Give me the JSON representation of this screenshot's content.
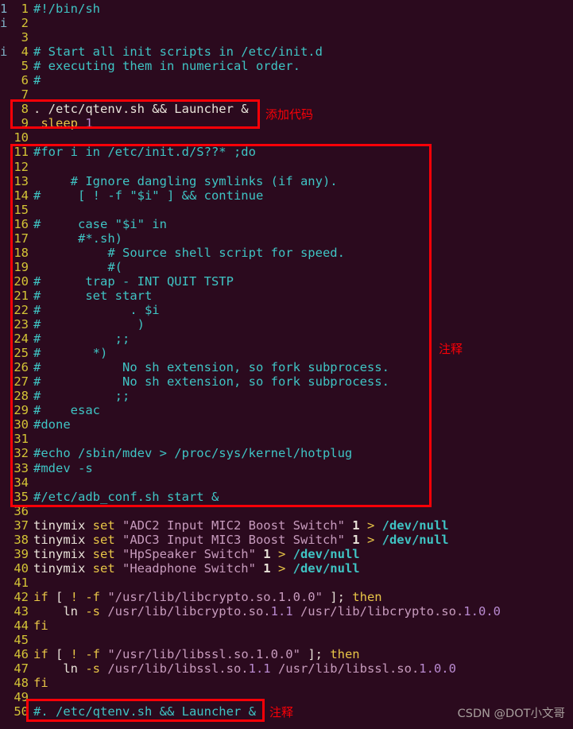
{
  "editor": {
    "filetype": "shell-script",
    "background_color": "#2b0a1e",
    "linenumber_color": "#d4c436",
    "comment_color": "#3fc4c4",
    "text_color": "#e8e2d8",
    "string_color": "#c79bbd",
    "number_color": "#b98ad0",
    "keyword_color": "#e8c547",
    "highlight_box_color": "#fb0007",
    "left_edge_sliver": "1\ni\n\ni"
  },
  "lines": [
    {
      "n": "1",
      "tokens": [
        {
          "t": "#!/bin/sh",
          "c": "cmt"
        }
      ]
    },
    {
      "n": "2",
      "tokens": []
    },
    {
      "n": "3",
      "tokens": []
    },
    {
      "n": "4",
      "tokens": [
        {
          "t": "# Start all init scripts in /etc/init.d",
          "c": "cmt"
        }
      ]
    },
    {
      "n": "5",
      "tokens": [
        {
          "t": "# executing them in numerical order.",
          "c": "cmt"
        }
      ]
    },
    {
      "n": "6",
      "tokens": [
        {
          "t": "#",
          "c": "cmt"
        }
      ]
    },
    {
      "n": "7",
      "tokens": []
    },
    {
      "n": "8",
      "tokens": [
        {
          "t": ". /etc/qtenv.sh && Launcher &",
          "c": "txt"
        }
      ]
    },
    {
      "n": "9",
      "tokens": [
        {
          "t": " sleep ",
          "c": "kw"
        },
        {
          "t": "1",
          "c": "num"
        }
      ]
    },
    {
      "n": "10",
      "tokens": []
    },
    {
      "n": "11",
      "tokens": [
        {
          "t": "#for i in /etc/init.d/S??* ;do",
          "c": "cmt"
        }
      ]
    },
    {
      "n": "12",
      "tokens": []
    },
    {
      "n": "13",
      "tokens": [
        {
          "t": "     # Ignore dangling symlinks (if any).",
          "c": "cmt"
        }
      ]
    },
    {
      "n": "14",
      "tokens": [
        {
          "t": "#     [ ! -f \"$i\" ] && continue",
          "c": "cmt"
        }
      ]
    },
    {
      "n": "15",
      "tokens": []
    },
    {
      "n": "16",
      "tokens": [
        {
          "t": "#     case \"$i\" in",
          "c": "cmt"
        }
      ]
    },
    {
      "n": "17",
      "tokens": [
        {
          "t": "      #*.sh)",
          "c": "cmt"
        }
      ]
    },
    {
      "n": "18",
      "tokens": [
        {
          "t": "          # Source shell script for speed.",
          "c": "cmt"
        }
      ]
    },
    {
      "n": "19",
      "tokens": [
        {
          "t": "          #(",
          "c": "cmt"
        }
      ]
    },
    {
      "n": "20",
      "tokens": [
        {
          "t": "#      trap - INT QUIT TSTP",
          "c": "cmt"
        }
      ]
    },
    {
      "n": "21",
      "tokens": [
        {
          "t": "#      set start",
          "c": "cmt"
        }
      ]
    },
    {
      "n": "22",
      "tokens": [
        {
          "t": "#            . $i",
          "c": "cmt"
        }
      ]
    },
    {
      "n": "23",
      "tokens": [
        {
          "t": "#             )",
          "c": "cmt"
        }
      ]
    },
    {
      "n": "24",
      "tokens": [
        {
          "t": "#          ;;",
          "c": "cmt"
        }
      ]
    },
    {
      "n": "25",
      "tokens": [
        {
          "t": "#       *)",
          "c": "cmt"
        }
      ]
    },
    {
      "n": "26",
      "tokens": [
        {
          "t": "#           No sh extension, so fork subprocess.",
          "c": "cmt"
        }
      ]
    },
    {
      "n": "27",
      "tokens": [
        {
          "t": "#           No sh extension, so fork subprocess.",
          "c": "cmt"
        }
      ]
    },
    {
      "n": "28",
      "tokens": [
        {
          "t": "#          ;;",
          "c": "cmt"
        }
      ]
    },
    {
      "n": "29",
      "tokens": [
        {
          "t": "#    esac",
          "c": "cmt"
        }
      ]
    },
    {
      "n": "30",
      "tokens": [
        {
          "t": "#done",
          "c": "cmt"
        }
      ]
    },
    {
      "n": "31",
      "tokens": []
    },
    {
      "n": "32",
      "tokens": [
        {
          "t": "#echo /sbin/mdev > /proc/sys/kernel/hotplug",
          "c": "cmt"
        }
      ]
    },
    {
      "n": "33",
      "tokens": [
        {
          "t": "#mdev -s",
          "c": "cmt"
        }
      ]
    },
    {
      "n": "34",
      "tokens": []
    },
    {
      "n": "35",
      "tokens": [
        {
          "t": "#/etc/adb_conf.sh start &",
          "c": "cmt"
        }
      ]
    },
    {
      "n": "36",
      "tokens": []
    },
    {
      "n": "37",
      "tokens": [
        {
          "t": "tinymix ",
          "c": "txt"
        },
        {
          "t": "set ",
          "c": "kw"
        },
        {
          "t": "\"ADC2 Input MIC2 Boost Switch\" ",
          "c": "str"
        },
        {
          "t": "1",
          "c": "txt bold"
        },
        {
          "t": " > ",
          "c": "op"
        },
        {
          "t": "/dev/null",
          "c": "path bold"
        }
      ]
    },
    {
      "n": "38",
      "tokens": [
        {
          "t": "tinymix ",
          "c": "txt"
        },
        {
          "t": "set ",
          "c": "kw"
        },
        {
          "t": "\"ADC3 Input MIC3 Boost Switch\" ",
          "c": "str"
        },
        {
          "t": "1",
          "c": "txt bold"
        },
        {
          "t": " > ",
          "c": "op"
        },
        {
          "t": "/dev/null",
          "c": "path bold"
        }
      ]
    },
    {
      "n": "39",
      "tokens": [
        {
          "t": "tinymix ",
          "c": "txt"
        },
        {
          "t": "set ",
          "c": "kw"
        },
        {
          "t": "\"HpSpeaker Switch\" ",
          "c": "str"
        },
        {
          "t": "1",
          "c": "txt bold"
        },
        {
          "t": " > ",
          "c": "op"
        },
        {
          "t": "/dev/null",
          "c": "path bold"
        }
      ]
    },
    {
      "n": "40",
      "tokens": [
        {
          "t": "tinymix ",
          "c": "txt"
        },
        {
          "t": "set ",
          "c": "kw"
        },
        {
          "t": "\"Headphone Switch\" ",
          "c": "str"
        },
        {
          "t": "1",
          "c": "txt bold"
        },
        {
          "t": " > ",
          "c": "op"
        },
        {
          "t": "/dev/null",
          "c": "path bold"
        }
      ]
    },
    {
      "n": "41",
      "tokens": []
    },
    {
      "n": "42",
      "tokens": [
        {
          "t": "if ",
          "c": "kw"
        },
        {
          "t": "[ ",
          "c": "txt"
        },
        {
          "t": "! ",
          "c": "kw"
        },
        {
          "t": "-f ",
          "c": "kw"
        },
        {
          "t": "\"/usr/lib/libcrypto.so.1.0.0\"",
          "c": "str"
        },
        {
          "t": " ];",
          "c": "txt"
        },
        {
          "t": " then",
          "c": "kw"
        }
      ]
    },
    {
      "n": "43",
      "tokens": [
        {
          "t": "    ln ",
          "c": "txt"
        },
        {
          "t": "-s ",
          "c": "kw"
        },
        {
          "t": "/usr/lib/libcrypto.so.",
          "c": "str"
        },
        {
          "t": "1.1",
          "c": "num"
        },
        {
          "t": " /usr/lib/libcrypto.so.",
          "c": "str"
        },
        {
          "t": "1.0.0",
          "c": "num"
        }
      ]
    },
    {
      "n": "44",
      "tokens": [
        {
          "t": "fi",
          "c": "kw"
        }
      ]
    },
    {
      "n": "45",
      "tokens": []
    },
    {
      "n": "46",
      "tokens": [
        {
          "t": "if ",
          "c": "kw"
        },
        {
          "t": "[ ",
          "c": "txt"
        },
        {
          "t": "! ",
          "c": "kw"
        },
        {
          "t": "-f ",
          "c": "kw"
        },
        {
          "t": "\"/usr/lib/libssl.so.1.0.0\"",
          "c": "str"
        },
        {
          "t": " ];",
          "c": "txt"
        },
        {
          "t": " then",
          "c": "kw"
        }
      ]
    },
    {
      "n": "47",
      "tokens": [
        {
          "t": "    ln ",
          "c": "txt"
        },
        {
          "t": "-s ",
          "c": "kw"
        },
        {
          "t": "/usr/lib/libssl.so.",
          "c": "str"
        },
        {
          "t": "1.1",
          "c": "num"
        },
        {
          "t": " /usr/lib/libssl.so.",
          "c": "str"
        },
        {
          "t": "1.0.0",
          "c": "num"
        }
      ]
    },
    {
      "n": "48",
      "tokens": [
        {
          "t": "fi",
          "c": "kw"
        }
      ]
    },
    {
      "n": "49",
      "tokens": []
    },
    {
      "n": "50",
      "tokens": [
        {
          "t": "#. /etc/qtenv.sh && Launcher &",
          "c": "cmt"
        }
      ]
    }
  ],
  "annotations": {
    "added_code": "添加代码",
    "comment_mid": "注释",
    "comment_bottom": "注释"
  },
  "watermark": "CSDN @DOT小文哥"
}
